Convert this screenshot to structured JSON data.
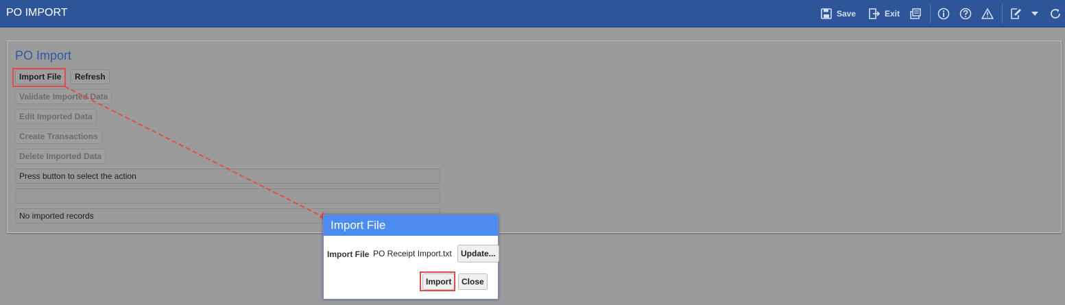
{
  "app": {
    "title": "PO IMPORT"
  },
  "toolbar": {
    "save_label": "Save",
    "exit_label": "Exit",
    "icons": [
      "save-icon",
      "exit-icon",
      "print-icon",
      "info-icon",
      "help-icon",
      "warning-icon",
      "edit-icon",
      "chevron-down-icon",
      "refresh-icon"
    ]
  },
  "panel": {
    "title": "PO Import",
    "buttons": {
      "import_file": "Import File",
      "refresh": "Refresh",
      "validate": "Validate Imported Data",
      "edit": "Edit Imported Data",
      "create": "Create Transactions",
      "delete": "Delete Imported Data"
    },
    "status_message": "Press button to select the action",
    "progress_text": "",
    "records_message": "No imported records"
  },
  "dialog": {
    "title": "Import File",
    "field_label": "Import File",
    "file_name": "PO Receipt Import.txt",
    "update_label": "Update...",
    "import_label": "Import",
    "close_label": "Close"
  },
  "colors": {
    "header": "#2d5597",
    "dialog_header": "#4a8cf0",
    "highlight": "#e34b4b",
    "overlay": "#9b9b9b"
  }
}
